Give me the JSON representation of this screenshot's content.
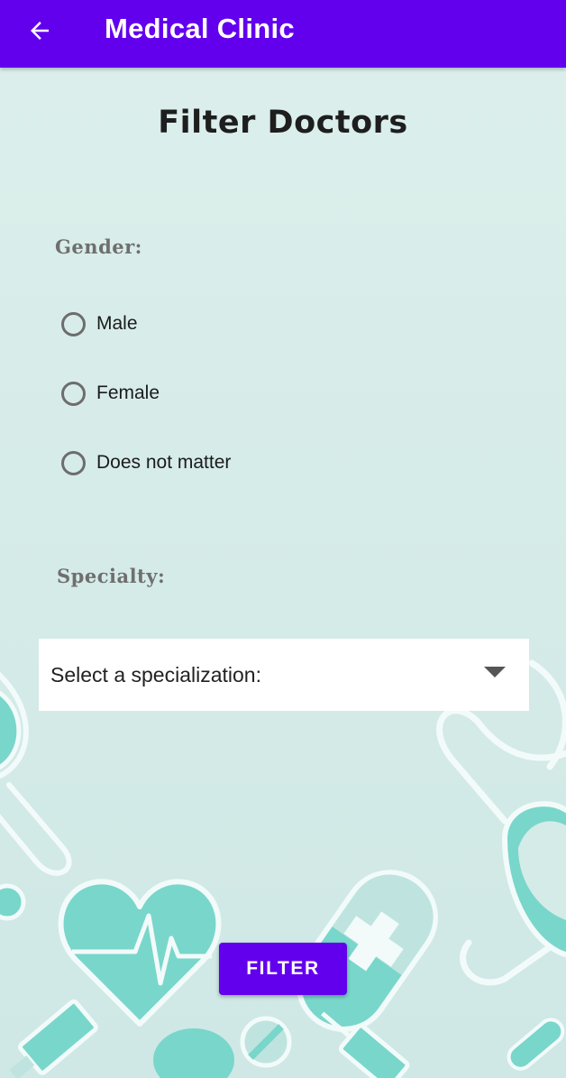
{
  "app_bar": {
    "title": "Medical Clinic",
    "back_icon": "arrow-left-icon",
    "background_color": "#6200ee"
  },
  "page": {
    "title": "Filter Doctors"
  },
  "gender": {
    "label": "Gender:",
    "options": [
      {
        "label": "Male",
        "selected": false
      },
      {
        "label": "Female",
        "selected": false
      },
      {
        "label": "Does not matter",
        "selected": false
      }
    ]
  },
  "specialty": {
    "label": "Specialty:",
    "selected_value": "Select a specialization:",
    "dropdown_icon": "caret-down-icon"
  },
  "actions": {
    "filter_label": "FILTER",
    "accent_color": "#6200ee"
  },
  "background": {
    "decor_color": "#79d6cb",
    "outline_color": "#f2fbfa"
  }
}
